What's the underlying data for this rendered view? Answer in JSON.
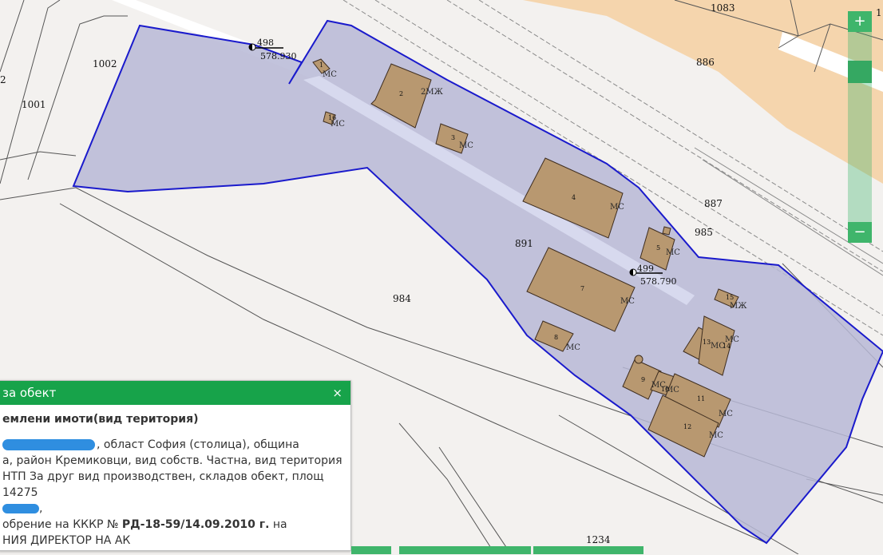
{
  "map": {
    "plot_labels": [
      "1083",
      "886",
      "887",
      "985",
      "891",
      "984",
      "1002",
      "1001",
      "1234",
      "2",
      "1"
    ],
    "survey_points": [
      {
        "id": "498",
        "elevation": "578.930"
      },
      {
        "id": "499",
        "elevation": "578.790"
      }
    ],
    "buildings": [
      {
        "num": "1",
        "type": "МС"
      },
      {
        "num": "2",
        "type": "2МЖ"
      },
      {
        "num": "3",
        "type": "МС"
      },
      {
        "num": "4",
        "type": "МС"
      },
      {
        "num": "5",
        "type": "МС"
      },
      {
        "num": "6",
        "type": ""
      },
      {
        "num": "7",
        "type": "МС"
      },
      {
        "num": "8",
        "type": "МС"
      },
      {
        "num": "9",
        "type": "МС"
      },
      {
        "num": "10",
        "type": "МС"
      },
      {
        "num": "11",
        "type": "МС"
      },
      {
        "num": "12",
        "type": "МС"
      },
      {
        "num": "13",
        "type": "МС"
      },
      {
        "num": "14",
        "type": "МС"
      },
      {
        "num": "15",
        "type": "МЖ"
      },
      {
        "num": "16",
        "type": "МС"
      }
    ],
    "colors": {
      "selected_fill": "#b7b9d6",
      "selected_border": "#1a1acc",
      "building_fill": "#b89870",
      "orange_zone": "#f5d5ad",
      "background": "#f3f1ef"
    }
  },
  "zoom": {
    "plus_label": "+",
    "minus_label": "−"
  },
  "info_panel": {
    "title": "за обект",
    "close_label": "×",
    "heading": "емлени имоти(вид територия)",
    "lines": [
      ", област София (столица), община",
      "а, район Кремиковци, вид собств. Частна, вид територия",
      "НТП За друг вид производствен, складов обект, площ 14275",
      ",",
      "обрение на КККР № ",
      "НИЯ ДИРЕКТОР НА АК"
    ],
    "order_number": "РД-18-59/14.09.2010 г.",
    "order_suffix": " на"
  }
}
